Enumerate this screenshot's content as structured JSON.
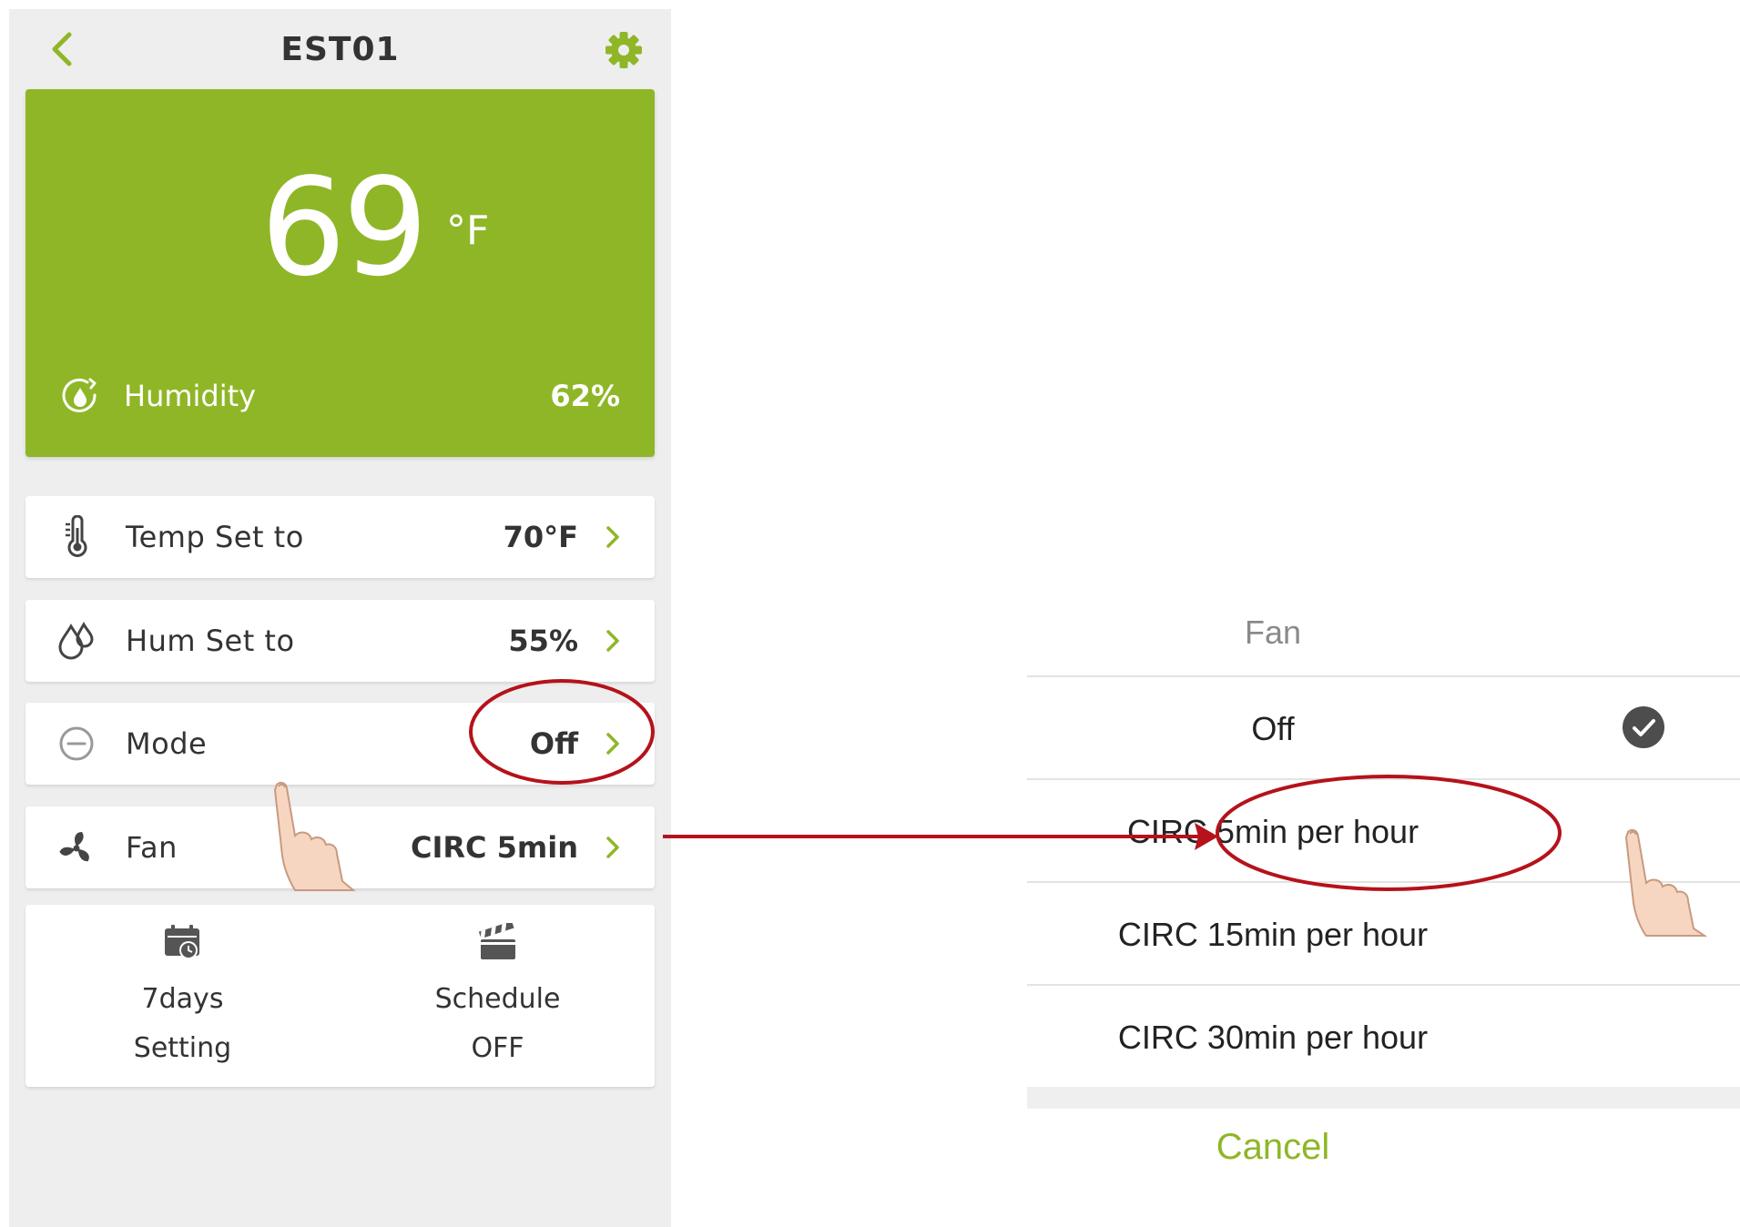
{
  "colors": {
    "accent": "#8fb627",
    "annotation": "#b5121b",
    "background": "#eeeeee"
  },
  "header": {
    "title": "EST01",
    "back_icon": "chevron-left-icon",
    "settings_icon": "gear-icon"
  },
  "hero": {
    "temperature": "69",
    "unit": "°F",
    "humidity_label": "Humidity",
    "humidity_value": "62%"
  },
  "rows": [
    {
      "label": "Temp Set to",
      "value": "70°F",
      "icon": "thermometer-icon"
    },
    {
      "label": "Hum Set to",
      "value": "55%",
      "icon": "water-drops-icon"
    },
    {
      "label": "Mode",
      "value": "Off",
      "icon": "minus-circle-icon"
    },
    {
      "label": "Fan",
      "value": "CIRC 5min",
      "icon": "fan-icon"
    }
  ],
  "bottom": [
    {
      "line1": "7days",
      "line2": "Setting",
      "icon": "calendar-clock-icon"
    },
    {
      "line1": "Schedule",
      "line2": "OFF",
      "icon": "clapperboard-icon"
    }
  ],
  "fan_sheet": {
    "title": "Fan",
    "options": [
      "Off",
      "CIRC 5min per hour",
      "CIRC 15min per hour",
      "CIRC 30min per hour"
    ],
    "selected": "Off",
    "cancel_label": "Cancel"
  }
}
